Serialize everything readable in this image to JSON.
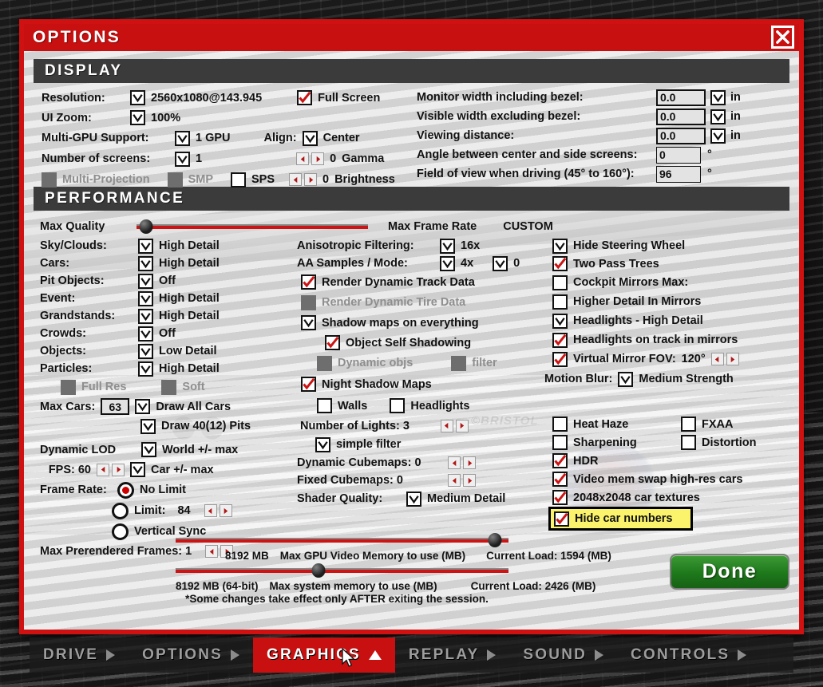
{
  "window": {
    "title": "OPTIONS",
    "close_icon": "close-x-icon"
  },
  "display": {
    "header": "DISPLAY",
    "resolution_label": "Resolution:",
    "resolution_value": "2560x1080@143.945",
    "ui_zoom_label": "UI Zoom:",
    "ui_zoom_value": "100%",
    "multi_gpu_label": "Multi-GPU Support:",
    "multi_gpu_value": "1 GPU",
    "num_screens_label": "Number of screens:",
    "num_screens_value": "1",
    "multi_projection_label": "Multi-Projection",
    "smp_label": "SMP",
    "sps_label": "SPS",
    "full_screen_label": "Full Screen",
    "align_label": "Align:",
    "align_value": "Center",
    "gamma_value": "0",
    "gamma_label": "Gamma",
    "brightness_value": "0",
    "brightness_label": "Brightness",
    "monitor_width_label": "Monitor width including bezel:",
    "monitor_width_value": "0.0",
    "visible_width_label": "Visible width excluding bezel:",
    "visible_width_value": "0.0",
    "viewing_distance_label": "Viewing distance:",
    "viewing_distance_value": "0.0",
    "angle_label": "Angle between center and side screens:",
    "angle_value": "0",
    "fov_label": "Field of view when driving (45° to 160°):",
    "fov_value": "96",
    "unit_in": "in",
    "unit_deg": "°"
  },
  "performance": {
    "header": "PERFORMANCE",
    "max_quality_label": "Max Quality",
    "max_frame_rate_label": "Max Frame Rate",
    "max_frame_rate_value": "CUSTOM",
    "left": {
      "sky_clouds_label": "Sky/Clouds:",
      "sky_clouds_value": "High Detail",
      "cars_label": "Cars:",
      "cars_value": "High Detail",
      "pit_objects_label": "Pit Objects:",
      "pit_objects_value": "Off",
      "event_label": "Event:",
      "event_value": "High Detail",
      "grandstands_label": "Grandstands:",
      "grandstands_value": "High Detail",
      "crowds_label": "Crowds:",
      "crowds_value": "Off",
      "objects_label": "Objects:",
      "objects_value": "Low Detail",
      "particles_label": "Particles:",
      "particles_value": "High Detail",
      "full_res_label": "Full Res",
      "soft_label": "Soft",
      "max_cars_label": "Max Cars:",
      "max_cars_value": "63",
      "draw_all_cars_label": "Draw All Cars",
      "draw_pits_label": "Draw 40(12) Pits",
      "dynamic_lod_label": "Dynamic LOD",
      "world_max_label": "World +/- max",
      "fps_label": "FPS: 60",
      "car_max_label": "Car +/- max",
      "frame_rate_label": "Frame Rate:",
      "no_limit_label": "No Limit",
      "limit_label": "Limit:",
      "limit_value": "84",
      "vertical_sync_label": "Vertical Sync",
      "max_prerendered_label": "Max Prerendered Frames: 1"
    },
    "middle": {
      "aniso_label": "Anisotropic Filtering:",
      "aniso_value": "16x",
      "aa_label": "AA Samples / Mode:",
      "aa_value": "4x",
      "aa_mode_value": "0",
      "render_track_data_label": "Render Dynamic Track Data",
      "render_tire_data_label": "Render Dynamic Tire Data",
      "shadow_maps_label": "Shadow maps on everything",
      "object_self_shadow_label": "Object Self Shadowing",
      "dynamic_objs_label": "Dynamic objs",
      "filter_label": "filter",
      "night_shadow_label": "Night Shadow Maps",
      "walls_label": "Walls",
      "headlights_label": "Headlights",
      "num_lights_label": "Number of Lights: 3",
      "simple_filter_label": "simple filter",
      "dynamic_cubemaps_label": "Dynamic Cubemaps: 0",
      "fixed_cubemaps_label": "Fixed Cubemaps: 0",
      "shader_quality_label": "Shader Quality:",
      "shader_quality_value": "Medium Detail"
    },
    "right": {
      "hide_steering_wheel_label": "Hide Steering Wheel",
      "two_pass_trees_label": "Two Pass Trees",
      "cockpit_mirrors_label": "Cockpit Mirrors  Max:",
      "higher_detail_mirrors_label": "Higher Detail In Mirrors",
      "headlights_high_detail_label": "Headlights - High Detail",
      "headlights_track_mirrors_label": "Headlights on track in mirrors",
      "virtual_mirror_label": "Virtual Mirror  FOV:",
      "virtual_mirror_fov": "120°",
      "motion_blur_label": "Motion Blur:",
      "motion_blur_value": "Medium Strength",
      "heat_haze_label": "Heat Haze",
      "fxaa_label": "FXAA",
      "sharpening_label": "Sharpening",
      "distortion_label": "Distortion",
      "hdr_label": "HDR",
      "video_mem_swap_label": "Video mem swap high-res cars",
      "car_textures_label": "2048x2048 car textures",
      "hide_car_numbers_label": "Hide car numbers"
    },
    "memory": {
      "gpu_value": "8192 MB",
      "gpu_label": "Max GPU Video Memory to use (MB)",
      "gpu_load": "Current Load: 1594 (MB)",
      "system_value": "8192 MB (64-bit)",
      "system_label": "Max system memory to use (MB)",
      "system_load": "Current Load: 2426 (MB)",
      "footnote": "*Some changes take effect only AFTER exiting the session."
    }
  },
  "done_button": "Done",
  "tabs": [
    {
      "label": "DRIVE",
      "active": false
    },
    {
      "label": "OPTIONS",
      "active": false
    },
    {
      "label": "GRAPHICS",
      "active": true
    },
    {
      "label": "REPLAY",
      "active": false
    },
    {
      "label": "SOUND",
      "active": false
    },
    {
      "label": "CONTROLS",
      "active": false
    }
  ],
  "colors": {
    "accent_red": "#c91010",
    "done_green": "#1f7a1c",
    "highlight_yellow": "#fbf36b"
  }
}
